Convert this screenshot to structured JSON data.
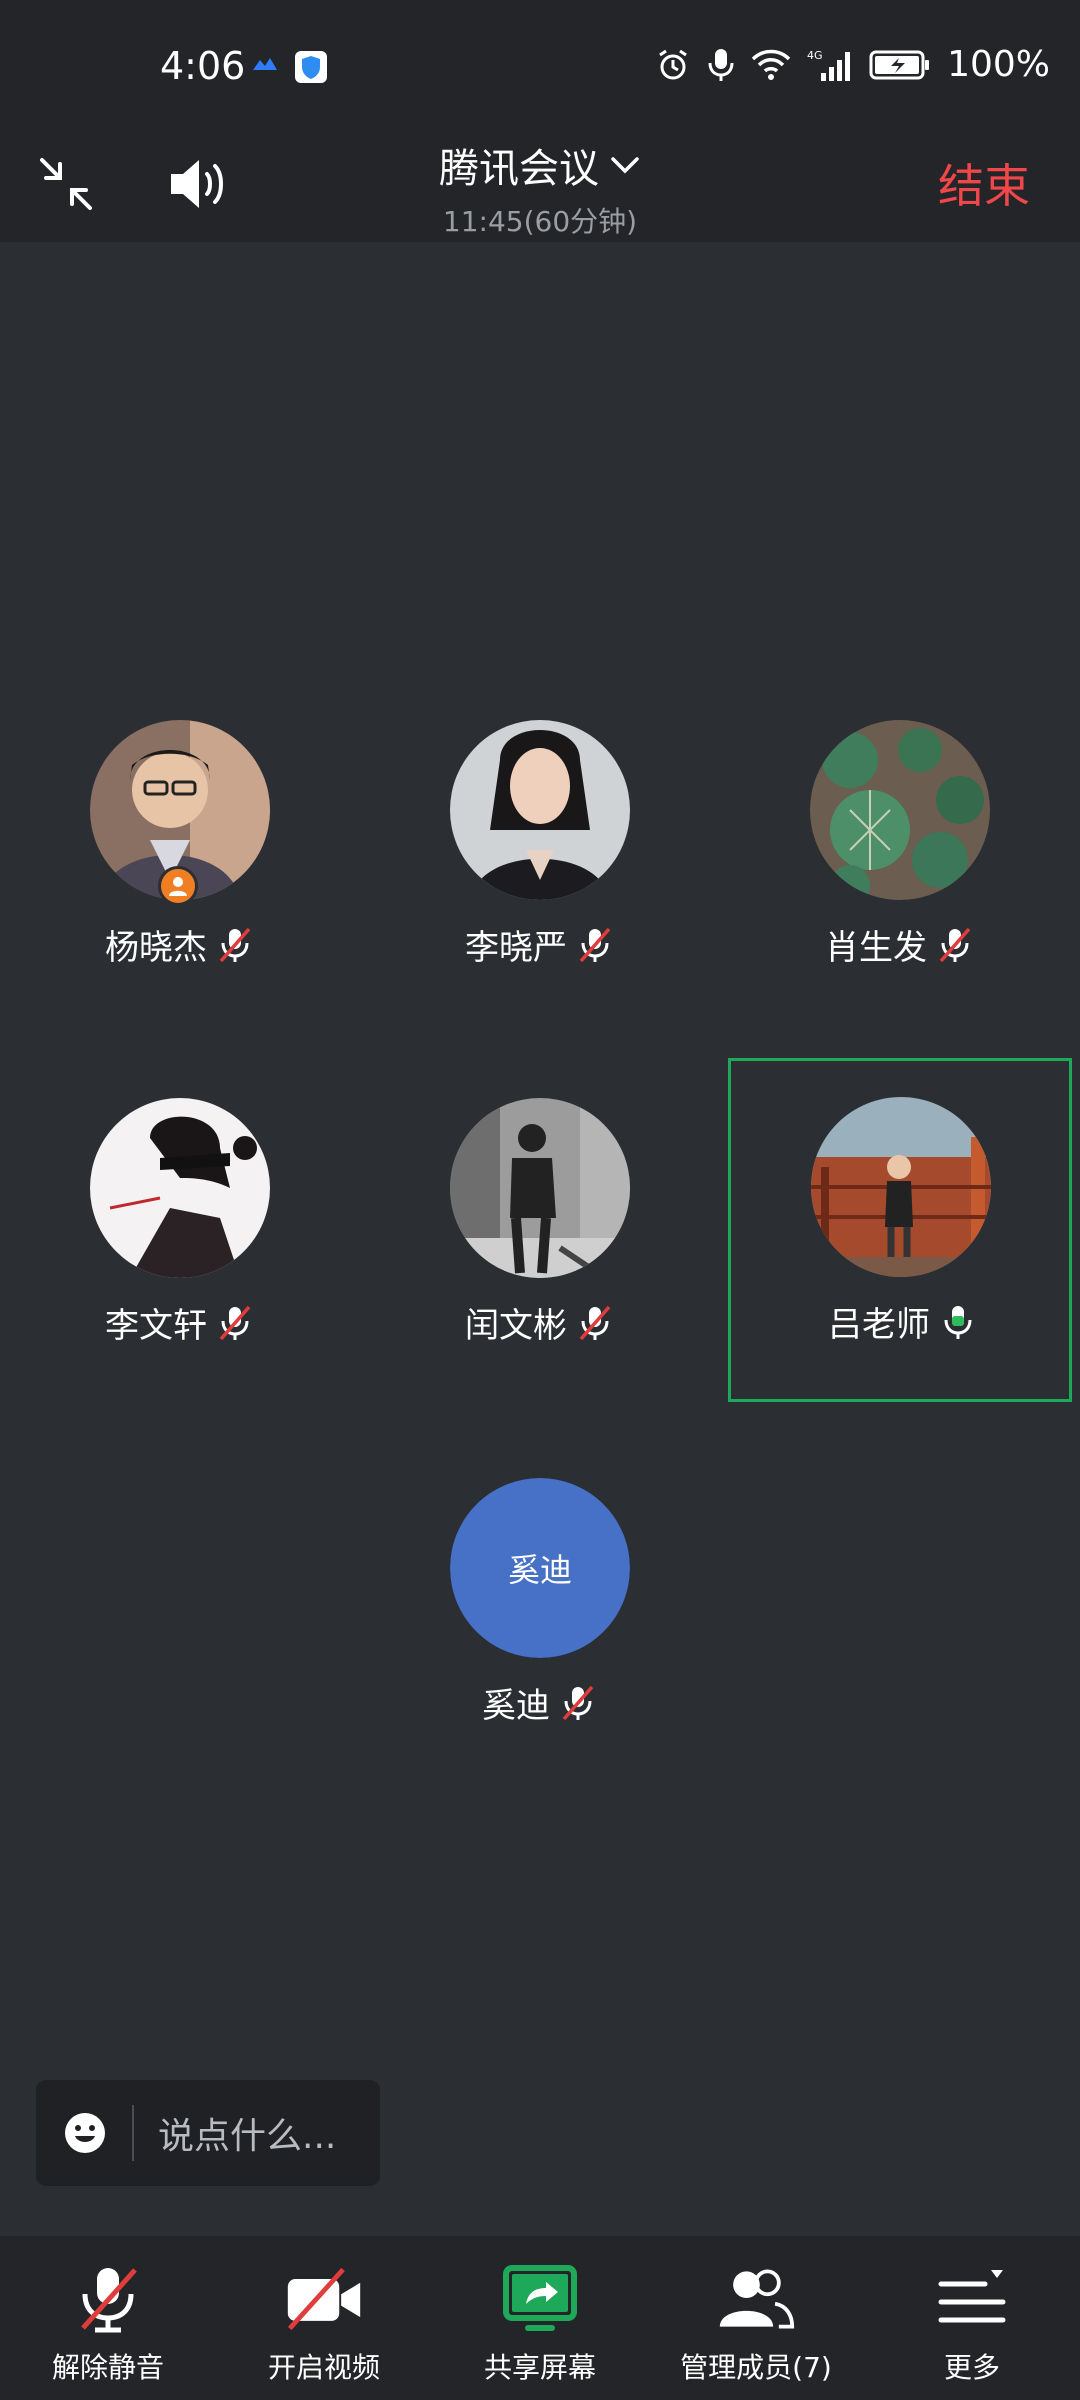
{
  "status_bar": {
    "time": "4:06",
    "battery": "100%",
    "network": "4G"
  },
  "header": {
    "title": "腾讯会议",
    "subtitle": "11:45(60分钟)",
    "end_label": "结束"
  },
  "participants": [
    {
      "name": "杨晓杰",
      "muted": true,
      "host": true
    },
    {
      "name": "李晓严",
      "muted": true
    },
    {
      "name": "肖生发",
      "muted": true
    },
    {
      "name": "李文轩",
      "muted": true
    },
    {
      "name": "闰文彬",
      "muted": true
    },
    {
      "name": "吕老师",
      "muted": false,
      "speaking": true
    },
    {
      "name": "奚迪",
      "muted": true,
      "avatar_text": "奚迪"
    }
  ],
  "chat": {
    "placeholder": "说点什么..."
  },
  "toolbar": {
    "unmute": "解除静音",
    "video": "开启视频",
    "share": "共享屏幕",
    "members": "管理成员(7)",
    "more": "更多"
  },
  "colors": {
    "end_red": "#f0474b",
    "speaking_green": "#1ea95a",
    "avatar_blue": "#4671c6",
    "share_green": "#1ea95a",
    "host_orange": "#f07f24"
  }
}
